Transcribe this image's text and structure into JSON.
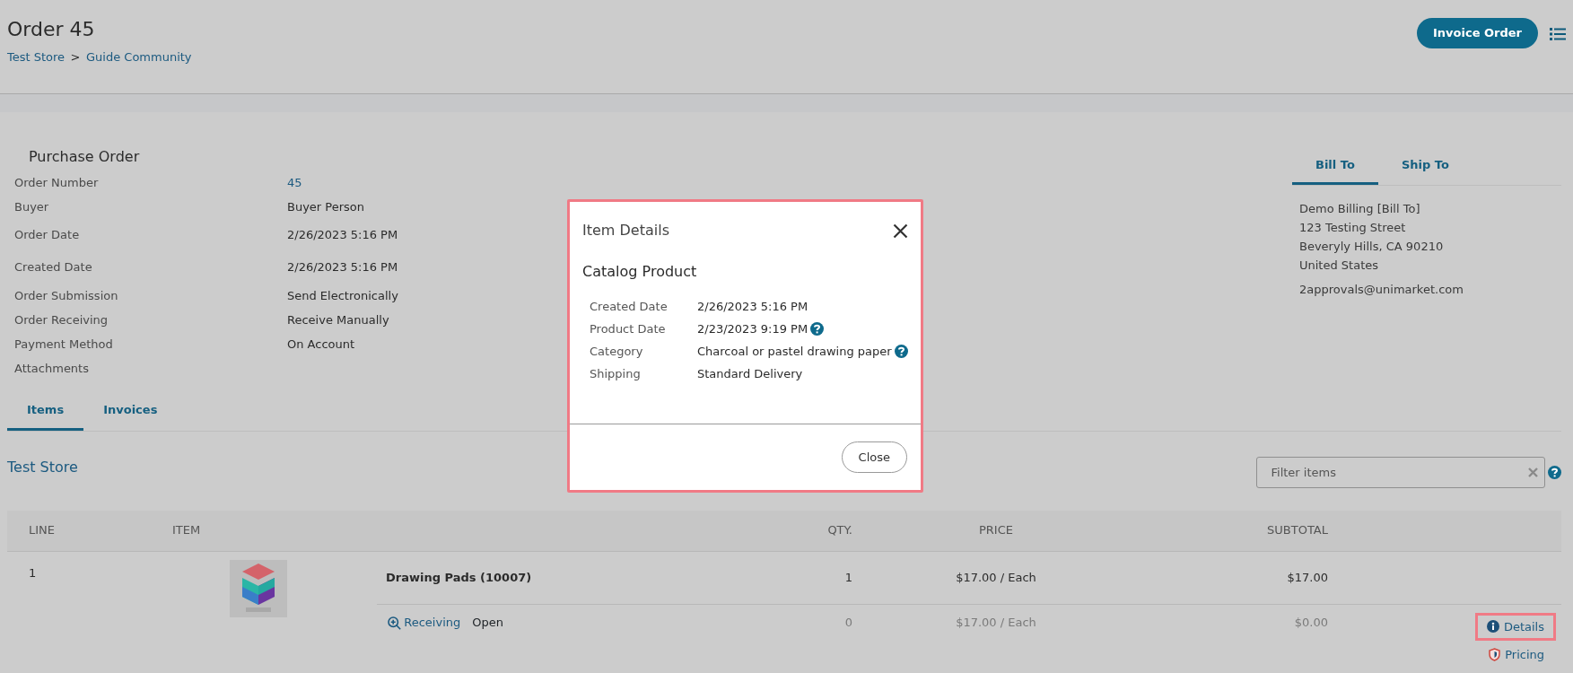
{
  "header": {
    "title": "Order 45",
    "breadcrumb": [
      {
        "label": "Test Store"
      },
      {
        "label": "Guide Community"
      }
    ],
    "separator": ">",
    "primary_button": "Invoice Order"
  },
  "purchase_order": {
    "title": "Purchase Order",
    "fields": [
      {
        "label": "Order Number",
        "value": "45",
        "kind": "link"
      },
      {
        "label": "Buyer",
        "value": "Buyer Person",
        "kind": "text"
      },
      {
        "label": "Order Date",
        "value": "2/26/2023 5:16 PM",
        "kind": "text"
      },
      {
        "label": "Created Date",
        "value": "2/26/2023 5:16 PM",
        "kind": "text"
      },
      {
        "label": "Order Submission",
        "value": "Send Electronically",
        "kind": "text"
      },
      {
        "label": "Order Receiving",
        "value": "Receive Manually",
        "kind": "text"
      },
      {
        "label": "Payment Method",
        "value": "On Account",
        "kind": "text"
      },
      {
        "label": "Attachments"
      }
    ]
  },
  "address_tabs": [
    {
      "label": "Bill To",
      "selected": true
    },
    {
      "label": "Ship To",
      "selected": false
    }
  ],
  "address": {
    "lines": [
      "Demo Billing [Bill To]",
      "123 Testing Street",
      "Beveryly Hills, CA 90210",
      "United States"
    ],
    "email": "2approvals@unimarket.com"
  },
  "tabs": [
    {
      "label": "Items",
      "selected": true
    },
    {
      "label": "Invoices",
      "selected": false
    }
  ],
  "store": {
    "name": "Test Store",
    "filter": {
      "placeholder": "Filter items"
    }
  },
  "table": {
    "columns": [
      "LINE",
      "ITEM",
      "QTY.",
      "PRICE",
      "SUBTOTAL"
    ],
    "rows": [
      {
        "line": "1",
        "item": "Drawing Pads (10007)",
        "qty": "1",
        "price": "$17.00 / Each",
        "subtotal": "$17.00",
        "receiving": {
          "link": "Receiving",
          "status": "Open",
          "qty": "0",
          "price": "$17.00 / Each",
          "subtotal": "$0.00"
        },
        "actions": [
          {
            "label": "Details",
            "kind": "info",
            "highlighted": true
          },
          {
            "label": "Pricing",
            "kind": "shield",
            "highlighted": false
          }
        ]
      }
    ]
  },
  "modal": {
    "title": "Item Details",
    "heading": "Catalog Product",
    "highlighted": true,
    "fields": [
      {
        "label": "Created Date",
        "value": "2/26/2023 5:16 PM",
        "help": false
      },
      {
        "label": "Product Date",
        "value": "2/23/2023 9:19 PM",
        "help": true
      },
      {
        "label": "Category",
        "value": "Charcoal or pastel drawing paper",
        "help": true
      },
      {
        "label": "Shipping",
        "value": "Standard Delivery",
        "help": false
      }
    ],
    "close_button": "Close"
  }
}
